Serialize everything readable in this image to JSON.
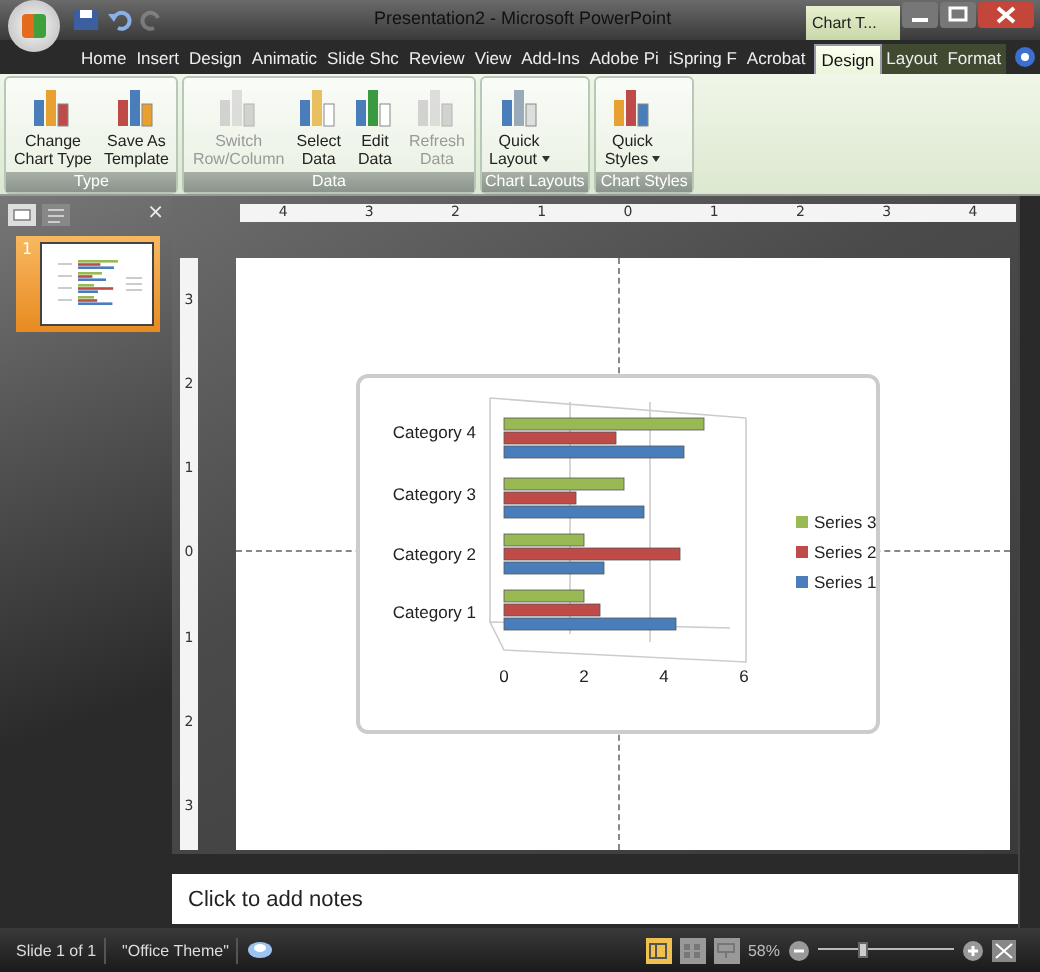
{
  "window": {
    "title": "Presentation2 - Microsoft PowerPoint",
    "context_label": "Chart T..."
  },
  "tabs": [
    {
      "label": "Home",
      "selected": false,
      "contextual": false
    },
    {
      "label": "Insert",
      "selected": false,
      "contextual": false
    },
    {
      "label": "Design",
      "selected": false,
      "contextual": false
    },
    {
      "label": "Animatic",
      "selected": false,
      "contextual": false
    },
    {
      "label": "Slide Shc",
      "selected": false,
      "contextual": false
    },
    {
      "label": "Review",
      "selected": false,
      "contextual": false
    },
    {
      "label": "View",
      "selected": false,
      "contextual": false
    },
    {
      "label": "Add-Ins",
      "selected": false,
      "contextual": false
    },
    {
      "label": "Adobe Pi",
      "selected": false,
      "contextual": false
    },
    {
      "label": "iSpring F",
      "selected": false,
      "contextual": false
    },
    {
      "label": "Acrobat",
      "selected": false,
      "contextual": false
    },
    {
      "label": "Design",
      "selected": true,
      "contextual": true
    },
    {
      "label": "Layout",
      "selected": false,
      "contextual": true
    },
    {
      "label": "Format",
      "selected": false,
      "contextual": true
    }
  ],
  "ribbon": [
    {
      "label": "Type",
      "buttons": [
        {
          "lines": [
            "Change",
            "Chart Type"
          ],
          "disabled": false,
          "dropdown": false
        },
        {
          "lines": [
            "Save As",
            "Template"
          ],
          "disabled": false,
          "dropdown": false
        }
      ]
    },
    {
      "label": "Data",
      "buttons": [
        {
          "lines": [
            "Switch",
            "Row/Column"
          ],
          "disabled": true,
          "dropdown": false
        },
        {
          "lines": [
            "Select",
            "Data"
          ],
          "disabled": false,
          "dropdown": false
        },
        {
          "lines": [
            "Edit",
            "Data"
          ],
          "disabled": false,
          "dropdown": false
        },
        {
          "lines": [
            "Refresh",
            "Data"
          ],
          "disabled": true,
          "dropdown": false
        }
      ]
    },
    {
      "label": "Chart Layouts",
      "buttons": [
        {
          "lines": [
            "Quick",
            "Layout"
          ],
          "disabled": false,
          "dropdown": true
        }
      ]
    },
    {
      "label": "Chart Styles",
      "buttons": [
        {
          "lines": [
            "Quick",
            "Styles"
          ],
          "disabled": false,
          "dropdown": true
        }
      ]
    }
  ],
  "slides_panel": {
    "close": "×",
    "thumbnails": [
      {
        "number": "1",
        "selected": true
      }
    ]
  },
  "rulers": {
    "horizontal": [
      "4",
      "3",
      "2",
      "1",
      "0",
      "1",
      "2",
      "3",
      "4"
    ],
    "vertical": [
      "3",
      "2",
      "1",
      "0",
      "1",
      "2",
      "3"
    ]
  },
  "chart": {
    "chart_data": {
      "type": "bar",
      "orientation": "horizontal",
      "categories": [
        "Category 4",
        "Category 3",
        "Category 2",
        "Category 1"
      ],
      "xticks": [
        0,
        2,
        4,
        6
      ],
      "xlim": [
        0,
        6
      ],
      "legend": "right",
      "series": [
        {
          "name": "Series 1",
          "color": "#4a7ebb",
          "values": [
            4.5,
            3.5,
            2.5,
            4.3
          ]
        },
        {
          "name": "Series 2",
          "color": "#be4b48",
          "values": [
            2.8,
            1.8,
            4.4,
            2.4
          ]
        },
        {
          "name": "Series 3",
          "color": "#98b954",
          "values": [
            5,
            3,
            2,
            2
          ]
        }
      ]
    }
  },
  "notes": {
    "placeholder": "Click to add notes"
  },
  "status_bar": {
    "slide": "Slide 1 of 1",
    "theme": "\"Office Theme\"",
    "views": [
      {
        "kind": "normal",
        "selected": true
      },
      {
        "kind": "sorter",
        "selected": false
      },
      {
        "kind": "show",
        "selected": false
      }
    ],
    "zoom": "58%",
    "zoom_level": {
      "level": 0.32
    }
  }
}
